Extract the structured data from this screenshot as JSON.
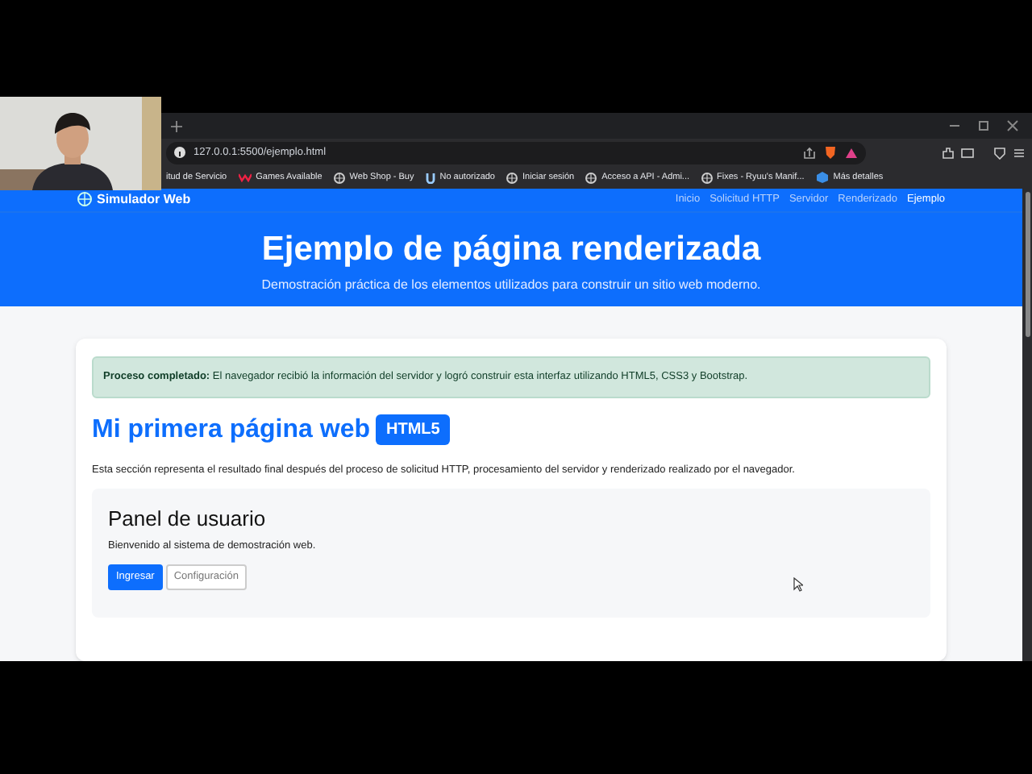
{
  "browser": {
    "url": "127.0.0.1:5500/ejemplo.html",
    "bookmarks": [
      {
        "label": "itud de Servicio",
        "kind": "none"
      },
      {
        "label": "Games Available",
        "kind": "mark"
      },
      {
        "label": "Web Shop - Buy",
        "kind": "globe"
      },
      {
        "label": "No autorizado",
        "kind": "u"
      },
      {
        "label": "Iniciar sesión",
        "kind": "globe"
      },
      {
        "label": "Acceso a API - Admi...",
        "kind": "globe"
      },
      {
        "label": "Fixes - Ryuu's Manif...",
        "kind": "globe"
      },
      {
        "label": "Más detalles",
        "kind": "box"
      }
    ]
  },
  "navbar": {
    "brand": "Simulador Web",
    "links": [
      {
        "label": "Inicio",
        "selected": false
      },
      {
        "label": "Solicitud HTTP",
        "selected": false
      },
      {
        "label": "Servidor",
        "selected": false
      },
      {
        "label": "Renderizado",
        "selected": false
      },
      {
        "label": "Ejemplo",
        "selected": true
      }
    ]
  },
  "hero": {
    "title": "Ejemplo de página renderizada",
    "subtitle": "Demostración práctica de los elementos utilizados para construir un sitio web moderno."
  },
  "alert": "**Proceso completado:** El navegador recibió la información del servidor y logró construir esta interfaz utilizando HTML5, CSS3 y Bootstrap.",
  "heading": "Mi primera página web",
  "badge": "HTML5",
  "intro": "Esta sección representa el resultado final después del proceso de solicitud HTTP, procesamiento del servidor y renderizado realizado por el navegador.",
  "panel": {
    "title": "Panel de usuario",
    "text": "Bienvenido al sistema de demostración web.",
    "buttons": [
      {
        "label": "Ingresar",
        "kind": "primary"
      },
      {
        "label": "Configuración",
        "kind": "outline"
      }
    ]
  }
}
